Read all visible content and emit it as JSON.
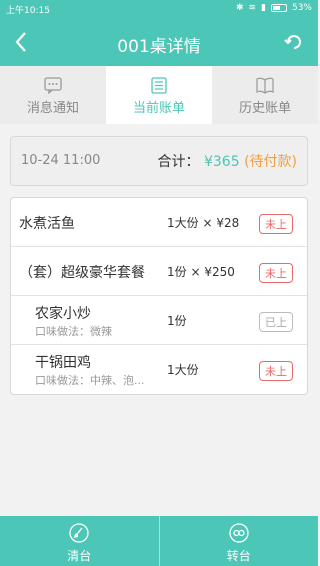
{
  "status_bar": {
    "time": "上午10:15",
    "battery": "53%"
  },
  "header": {
    "title": "001桌详情"
  },
  "tabs": [
    {
      "label": "消息通知",
      "active": false
    },
    {
      "label": "当前账单",
      "active": true
    },
    {
      "label": "历史账单",
      "active": false
    }
  ],
  "summary": {
    "datetime": "10-24  11:00",
    "total_label": "合计：",
    "amount": "¥365",
    "status": "(待付款)"
  },
  "orders": [
    {
      "name": "水煮活鱼",
      "note": "",
      "qty": "1大份 × ¥28",
      "badge": "未上",
      "badge_color": "#e56a6a"
    },
    {
      "name": "（套）超级豪华套餐",
      "note": "",
      "qty": "1份 × ¥250",
      "badge": "未上",
      "badge_color": "#e56a6a"
    },
    {
      "name": "农家小炒",
      "note": "口味做法：微辣",
      "qty": "1份",
      "badge": "已上",
      "badge_color": "#aaaaaa"
    },
    {
      "name": "干锅田鸡",
      "note": "口味做法：中辣、泡...",
      "qty": "1大份",
      "badge": "未上",
      "badge_color": "#e56a6a"
    }
  ],
  "bottom": {
    "clear_label": "清台",
    "transfer_label": "转台"
  },
  "colors": {
    "accent": "#4cc6b6",
    "warning": "#f0a040",
    "danger": "#e56a6a"
  }
}
